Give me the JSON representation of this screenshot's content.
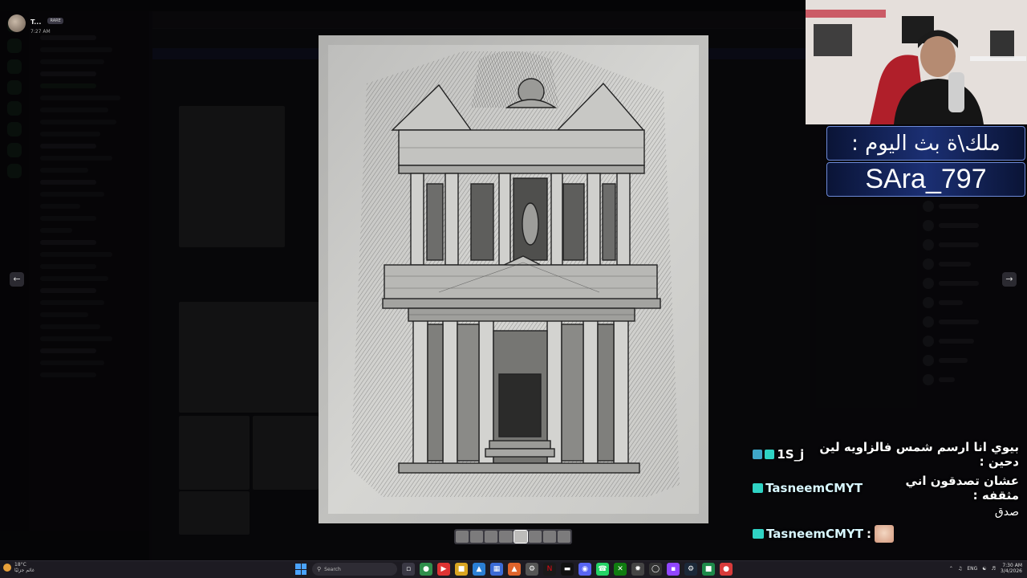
{
  "viewer": {
    "author": "T...",
    "tag": "RARE",
    "time": "7:27 AM",
    "prev_icon": "arrow-left-icon",
    "next_icon": "arrow-right-icon",
    "image_subject": "pencil-sketch-al-khazneh-petra",
    "thumbnail_count": 8,
    "active_thumbnail": 4
  },
  "stream": {
    "banner_title": "ملك\\ة بث اليوم :",
    "banner_user": "SAra_797",
    "chat": [
      {
        "user": "1S_j",
        "message": "بيوي انا ارسم شمس فالزاويه لين دحين :",
        "badge_color": "#3fa7c9"
      },
      {
        "user": "TasneemCMYT",
        "message": "عشان تصدقون اني مثقفه :",
        "continuation": "صدق",
        "badge_color": "#2fd3c4"
      },
      {
        "user": "TasneemCMYT",
        "message": ":",
        "emote": "face-emote",
        "badge_color": "#2fd3c4"
      }
    ]
  },
  "taskbar": {
    "weather_temp": "18°C",
    "weather_desc": "غائم جزئيًا",
    "search_placeholder": "Search",
    "language": "ENG",
    "time": "7:30 AM",
    "date": "3/4/2026",
    "accent": "#4aa3ff"
  }
}
